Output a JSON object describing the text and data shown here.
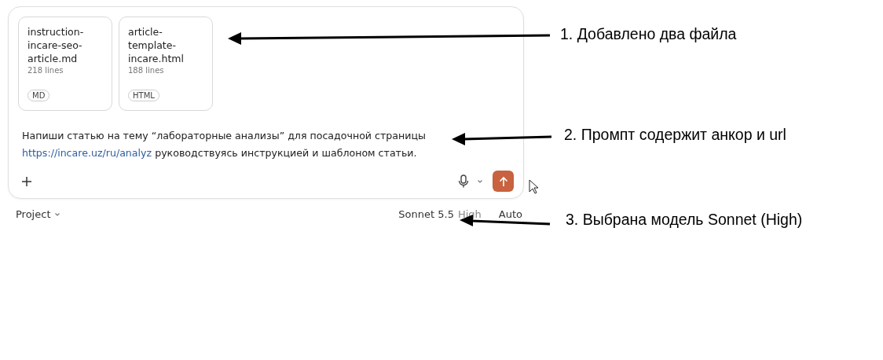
{
  "attachments": [
    {
      "name": "instruction-incare-seo-article.md",
      "lines": "218 lines",
      "type": "MD"
    },
    {
      "name": "article-template-incare.html",
      "lines": "188 lines",
      "type": "HTML"
    }
  ],
  "prompt": {
    "text": "Напиши статью на тему “лабораторные анализы” для посадочной страницы",
    "link": "https://incare.uz/ru/analyz",
    "rest": "руководствуясь инструкцией и шаблоном статьи."
  },
  "footer": {
    "project": "Project",
    "model": "Sonnet 5.5",
    "effort": "High",
    "mode": "Auto"
  },
  "annotations": [
    {
      "text": "1. Добавлено два файла"
    },
    {
      "text": "2. Промпт содержит анкор и url"
    },
    {
      "text": "3. Выбрана модель Sonnet (High)"
    }
  ]
}
